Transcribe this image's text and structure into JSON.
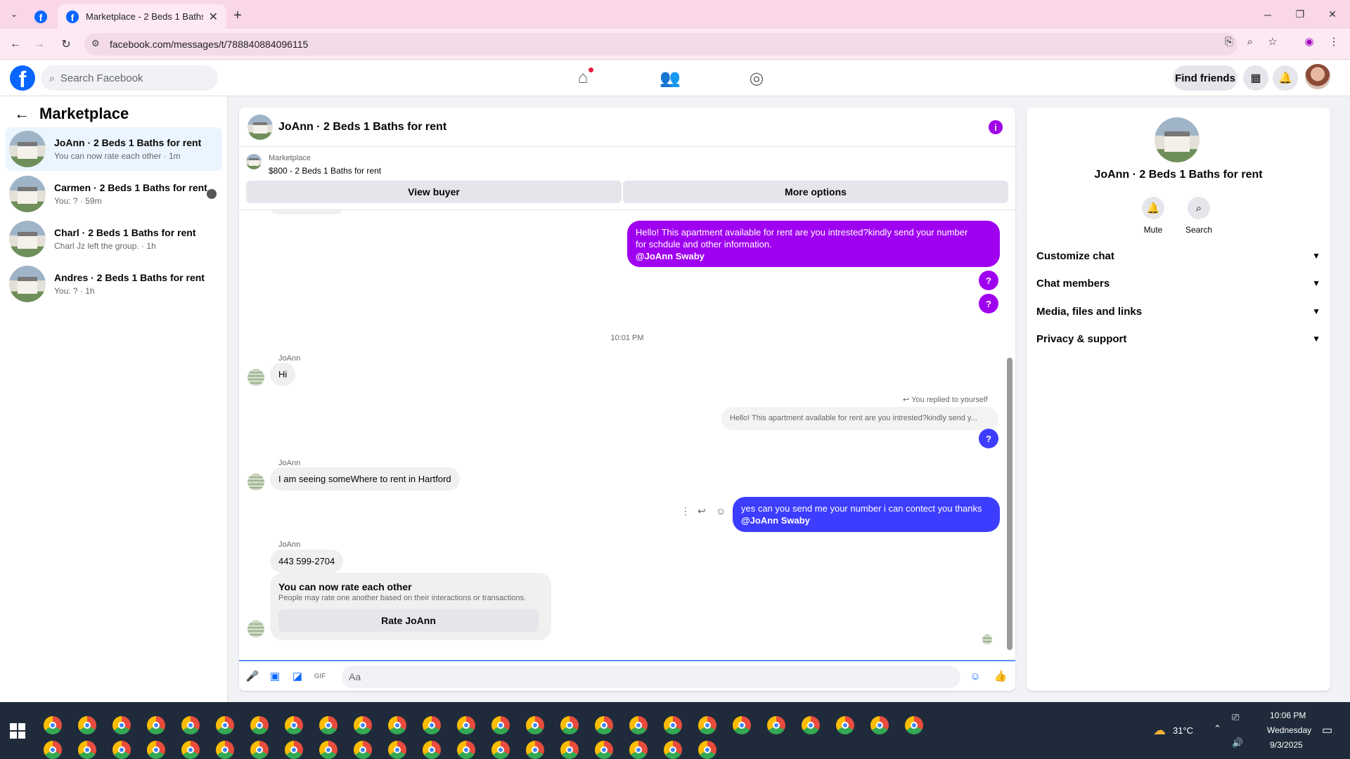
{
  "browser": {
    "tab_title": "Marketplace - 2 Beds 1 Baths fo",
    "close_glyph": "✕",
    "new_tab_glyph": "+",
    "url": "facebook.com/messages/t/788840884096115"
  },
  "fb": {
    "search_placeholder": "Search Facebook",
    "find_friends": "Find friends"
  },
  "sidebar": {
    "title": "Marketplace",
    "conversations": [
      {
        "name": "JoAnn · 2 Beds 1 Baths for rent",
        "sub": "You can now rate each other · 1m"
      },
      {
        "name": "Carmen · 2 Beds 1 Baths for rent",
        "sub": "You: ? · 59m"
      },
      {
        "name": "Charl · 2 Beds 1 Baths for rent",
        "sub": "Charl Jz left the group. · 1h"
      },
      {
        "name": "Andres · 2 Beds 1 Baths for rent",
        "sub": "You: ? · 1h"
      }
    ]
  },
  "chat": {
    "title": "JoAnn · 2 Beds 1 Baths for rent",
    "marketplace_label": "Marketplace",
    "listing": "$800 - 2 Beds 1 Baths for rent",
    "view_buyer": "View buyer",
    "more_options": "More options",
    "msg1_line1": "Hello! This apartment available for rent are you intrested?kindly send your number",
    "msg1_line2": "for schdule and other information.",
    "msg1_mention": "@JoAnn Swaby",
    "question": "?",
    "time1": "10:01 PM",
    "sender": "JoAnn",
    "hi": "Hi",
    "reply_note": "You replied to yourself",
    "reply_preview": "Hello! This apartment available for rent are you intrested?kindly send y...",
    "seeking": "I am seeing someWhere to rent in Hartford",
    "msg2": "yes can you send me your number i can contect you thanks",
    "msg2_mention": "@JoAnn Swaby",
    "phone": "443 599-2704",
    "rate_title": "You can now rate each other",
    "rate_desc": "People may rate one another based on their interactions or transactions.",
    "rate_btn": "Rate JoAnn",
    "composer_placeholder": "Aa"
  },
  "info_panel": {
    "name": "JoAnn · 2 Beds 1 Baths for rent",
    "mute": "Mute",
    "search": "Search",
    "sections": [
      "Customize chat",
      "Chat members",
      "Media, files and links",
      "Privacy & support"
    ]
  },
  "taskbar": {
    "temp": "31°C",
    "time": "10:06 PM",
    "day": "Wednesday",
    "date": "9/3/2025"
  },
  "colors": {
    "accent": "#a000f0",
    "blue": "#0866ff",
    "out2": "#3d3dff"
  }
}
